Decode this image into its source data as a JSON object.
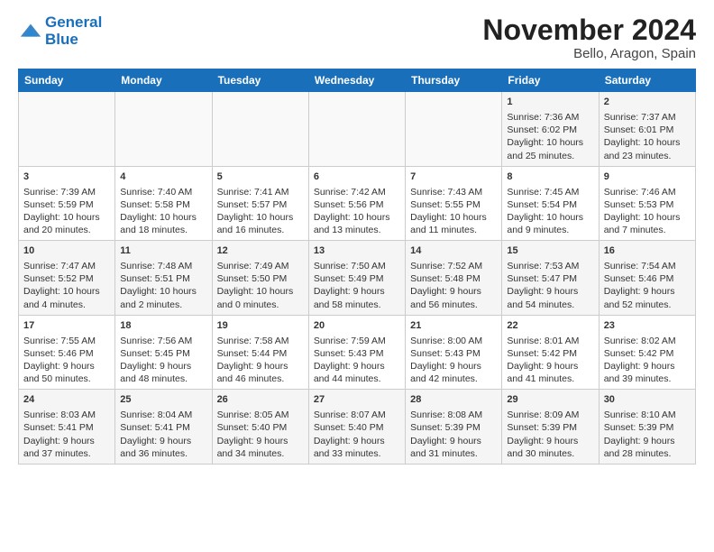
{
  "header": {
    "logo_line1": "General",
    "logo_line2": "Blue",
    "title": "November 2024",
    "subtitle": "Bello, Aragon, Spain"
  },
  "weekdays": [
    "Sunday",
    "Monday",
    "Tuesday",
    "Wednesday",
    "Thursday",
    "Friday",
    "Saturday"
  ],
  "weeks": [
    [
      {
        "day": "",
        "info": ""
      },
      {
        "day": "",
        "info": ""
      },
      {
        "day": "",
        "info": ""
      },
      {
        "day": "",
        "info": ""
      },
      {
        "day": "",
        "info": ""
      },
      {
        "day": "1",
        "info": "Sunrise: 7:36 AM\nSunset: 6:02 PM\nDaylight: 10 hours and 25 minutes."
      },
      {
        "day": "2",
        "info": "Sunrise: 7:37 AM\nSunset: 6:01 PM\nDaylight: 10 hours and 23 minutes."
      }
    ],
    [
      {
        "day": "3",
        "info": "Sunrise: 7:39 AM\nSunset: 5:59 PM\nDaylight: 10 hours and 20 minutes."
      },
      {
        "day": "4",
        "info": "Sunrise: 7:40 AM\nSunset: 5:58 PM\nDaylight: 10 hours and 18 minutes."
      },
      {
        "day": "5",
        "info": "Sunrise: 7:41 AM\nSunset: 5:57 PM\nDaylight: 10 hours and 16 minutes."
      },
      {
        "day": "6",
        "info": "Sunrise: 7:42 AM\nSunset: 5:56 PM\nDaylight: 10 hours and 13 minutes."
      },
      {
        "day": "7",
        "info": "Sunrise: 7:43 AM\nSunset: 5:55 PM\nDaylight: 10 hours and 11 minutes."
      },
      {
        "day": "8",
        "info": "Sunrise: 7:45 AM\nSunset: 5:54 PM\nDaylight: 10 hours and 9 minutes."
      },
      {
        "day": "9",
        "info": "Sunrise: 7:46 AM\nSunset: 5:53 PM\nDaylight: 10 hours and 7 minutes."
      }
    ],
    [
      {
        "day": "10",
        "info": "Sunrise: 7:47 AM\nSunset: 5:52 PM\nDaylight: 10 hours and 4 minutes."
      },
      {
        "day": "11",
        "info": "Sunrise: 7:48 AM\nSunset: 5:51 PM\nDaylight: 10 hours and 2 minutes."
      },
      {
        "day": "12",
        "info": "Sunrise: 7:49 AM\nSunset: 5:50 PM\nDaylight: 10 hours and 0 minutes."
      },
      {
        "day": "13",
        "info": "Sunrise: 7:50 AM\nSunset: 5:49 PM\nDaylight: 9 hours and 58 minutes."
      },
      {
        "day": "14",
        "info": "Sunrise: 7:52 AM\nSunset: 5:48 PM\nDaylight: 9 hours and 56 minutes."
      },
      {
        "day": "15",
        "info": "Sunrise: 7:53 AM\nSunset: 5:47 PM\nDaylight: 9 hours and 54 minutes."
      },
      {
        "day": "16",
        "info": "Sunrise: 7:54 AM\nSunset: 5:46 PM\nDaylight: 9 hours and 52 minutes."
      }
    ],
    [
      {
        "day": "17",
        "info": "Sunrise: 7:55 AM\nSunset: 5:46 PM\nDaylight: 9 hours and 50 minutes."
      },
      {
        "day": "18",
        "info": "Sunrise: 7:56 AM\nSunset: 5:45 PM\nDaylight: 9 hours and 48 minutes."
      },
      {
        "day": "19",
        "info": "Sunrise: 7:58 AM\nSunset: 5:44 PM\nDaylight: 9 hours and 46 minutes."
      },
      {
        "day": "20",
        "info": "Sunrise: 7:59 AM\nSunset: 5:43 PM\nDaylight: 9 hours and 44 minutes."
      },
      {
        "day": "21",
        "info": "Sunrise: 8:00 AM\nSunset: 5:43 PM\nDaylight: 9 hours and 42 minutes."
      },
      {
        "day": "22",
        "info": "Sunrise: 8:01 AM\nSunset: 5:42 PM\nDaylight: 9 hours and 41 minutes."
      },
      {
        "day": "23",
        "info": "Sunrise: 8:02 AM\nSunset: 5:42 PM\nDaylight: 9 hours and 39 minutes."
      }
    ],
    [
      {
        "day": "24",
        "info": "Sunrise: 8:03 AM\nSunset: 5:41 PM\nDaylight: 9 hours and 37 minutes."
      },
      {
        "day": "25",
        "info": "Sunrise: 8:04 AM\nSunset: 5:41 PM\nDaylight: 9 hours and 36 minutes."
      },
      {
        "day": "26",
        "info": "Sunrise: 8:05 AM\nSunset: 5:40 PM\nDaylight: 9 hours and 34 minutes."
      },
      {
        "day": "27",
        "info": "Sunrise: 8:07 AM\nSunset: 5:40 PM\nDaylight: 9 hours and 33 minutes."
      },
      {
        "day": "28",
        "info": "Sunrise: 8:08 AM\nSunset: 5:39 PM\nDaylight: 9 hours and 31 minutes."
      },
      {
        "day": "29",
        "info": "Sunrise: 8:09 AM\nSunset: 5:39 PM\nDaylight: 9 hours and 30 minutes."
      },
      {
        "day": "30",
        "info": "Sunrise: 8:10 AM\nSunset: 5:39 PM\nDaylight: 9 hours and 28 minutes."
      }
    ]
  ]
}
